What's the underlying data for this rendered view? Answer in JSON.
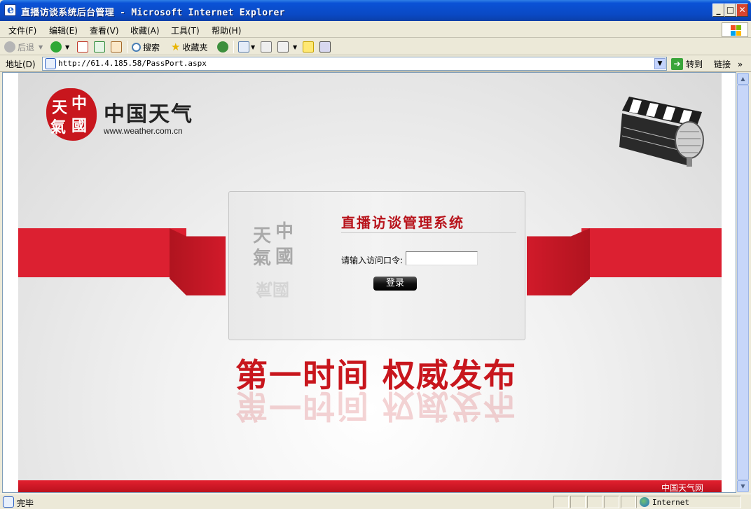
{
  "window": {
    "title": "直播访谈系统后台管理 - Microsoft Internet Explorer",
    "min_glyph": "_",
    "max_glyph": "□",
    "close_glyph": "✕"
  },
  "menu": [
    "文件(F)",
    "编辑(E)",
    "查看(V)",
    "收藏(A)",
    "工具(T)",
    "帮助(H)"
  ],
  "toolbar": {
    "back_label": "后退",
    "search_label": "搜索",
    "favorites_label": "收藏夹"
  },
  "address": {
    "label": "地址(D)",
    "url": "http://61.4.185.58/PassPort.aspx",
    "go_label": "转到",
    "links_label": "链接"
  },
  "page": {
    "brand_name": "中国天气",
    "brand_url": "www.weather.com.cn",
    "seal_chars": [
      "天",
      "中",
      "氣",
      "國"
    ],
    "panel_title": "直播访谈管理系统",
    "password_label": "请输入访问口令:",
    "password_value": "",
    "login_label": "登录",
    "slogan": "第一时间 权威发布",
    "footer": "中国天气网"
  },
  "status": {
    "text": "完毕",
    "zone": "Internet"
  },
  "colors": {
    "brand_red": "#c8161d",
    "ribbon_red": "#dc2031",
    "xp_blue": "#0a52d6"
  }
}
